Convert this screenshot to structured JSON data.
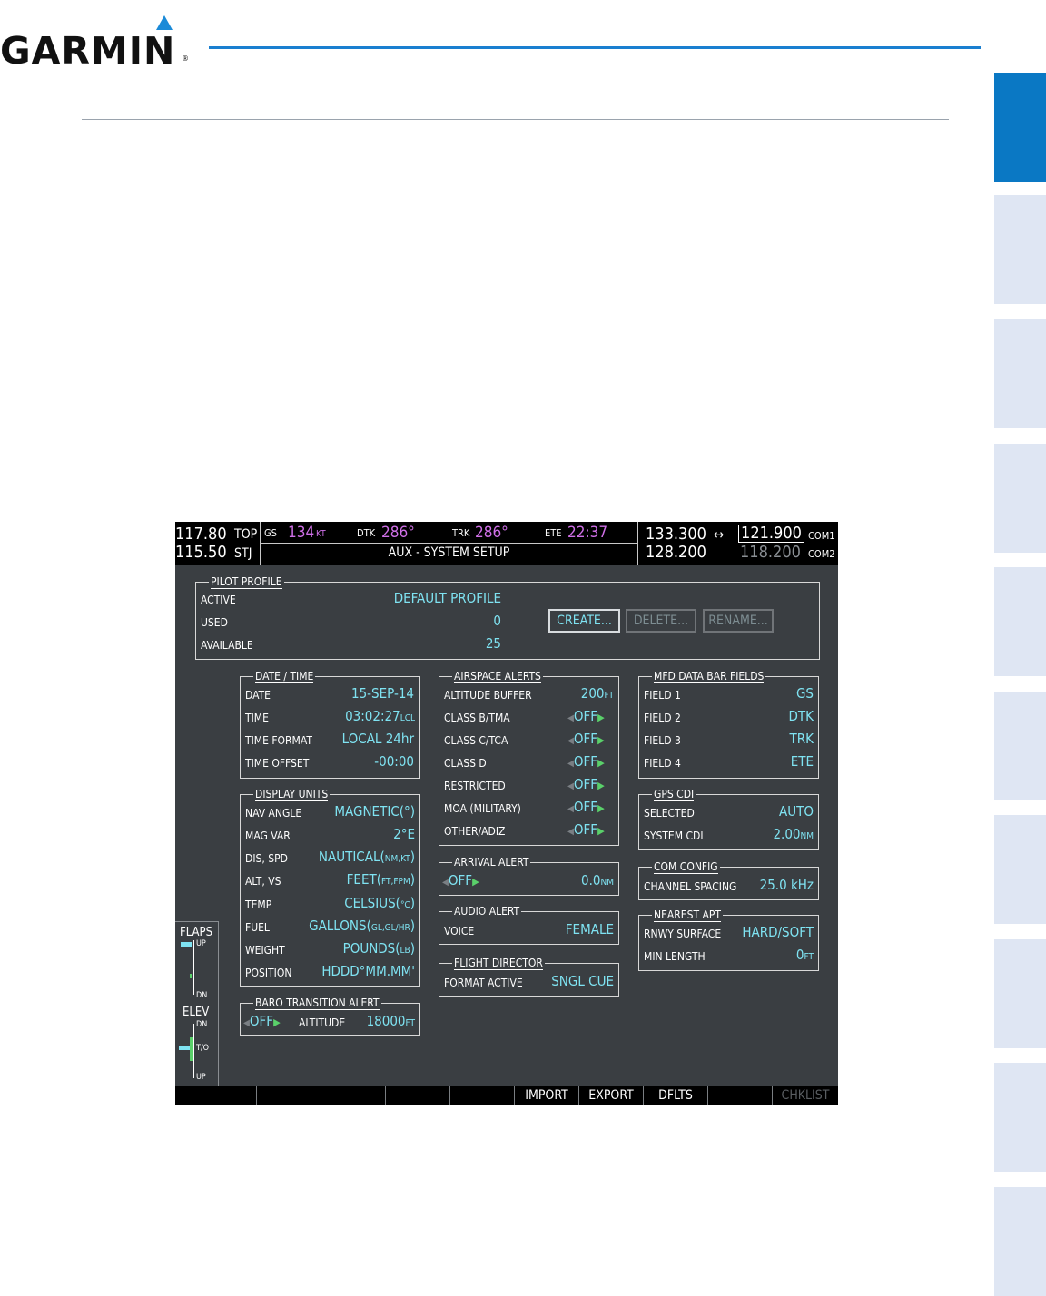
{
  "brand": {
    "logo_text": "GARMIN"
  },
  "screen": {
    "title": "AUX - SYSTEM SETUP",
    "topbar": {
      "nav1_active": "117.80",
      "nav1_ident": "TOP",
      "nav2_active": "115.50",
      "nav2_ident": "STJ",
      "gs_label": "GS",
      "gs_value": "134",
      "gs_unit": "KT",
      "dtk_label": "DTK",
      "dtk_value": "286°",
      "trk_label": "TRK",
      "trk_value": "286°",
      "ete_label": "ETE",
      "ete_value": "22:37",
      "com1_active": "133.300",
      "com1_standby": "121.900",
      "com1_label": "COM1",
      "swap_arrow": "↔",
      "com2_active": "128.200",
      "com2_standby": "118.200",
      "com2_label": "COM2"
    },
    "pilot_profile": {
      "title": "PILOT PROFILE",
      "active_label": "ACTIVE",
      "active_value": "DEFAULT PROFILE",
      "used_label": "USED",
      "used_value": "0",
      "available_label": "AVAILABLE",
      "available_value": "25",
      "create_label": "CREATE...",
      "delete_label": "DELETE...",
      "rename_label": "RENAME..."
    },
    "date_time": {
      "title": "DATE / TIME",
      "rows": [
        {
          "label": "DATE",
          "value": "15-SEP-14"
        },
        {
          "label": "TIME",
          "value": "03:02:27",
          "unit": "LCL"
        },
        {
          "label": "TIME FORMAT",
          "value": "LOCAL 24hr"
        },
        {
          "label": "TIME OFFSET",
          "value": "-00:00"
        }
      ]
    },
    "display_units": {
      "title": "DISPLAY UNITS",
      "rows": [
        {
          "label": "NAV ANGLE",
          "value": "MAGNETIC(°)"
        },
        {
          "label": "MAG VAR",
          "value": "2°E"
        },
        {
          "label": "DIS, SPD",
          "value": "NAUTICAL(",
          "unit": "NM,KT",
          "tail": ")"
        },
        {
          "label": "ALT, VS",
          "value": "FEET(",
          "unit": "FT,FPM",
          "tail": ")"
        },
        {
          "label": "TEMP",
          "value": "CELSIUS(",
          "unit": "°C",
          "tail": ")"
        },
        {
          "label": "FUEL",
          "value": "GALLONS(",
          "unit": "GL,GL/HR",
          "tail": ")"
        },
        {
          "label": "WEIGHT",
          "value": "POUNDS(",
          "unit": "LB",
          "tail": ")"
        },
        {
          "label": "POSITION",
          "value": "HDDD°MM.MM'"
        }
      ]
    },
    "baro_transition": {
      "title": "BARO TRANSITION ALERT",
      "state": "OFF",
      "altitude_label": "ALTITUDE",
      "altitude_value": "18000",
      "altitude_unit": "FT"
    },
    "airspace_alerts": {
      "title": "AIRSPACE ALERTS",
      "buffer_label": "ALTITUDE BUFFER",
      "buffer_value": "200",
      "buffer_unit": "FT",
      "rows": [
        {
          "label": "CLASS B/TMA",
          "value": "OFF"
        },
        {
          "label": "CLASS C/TCA",
          "value": "OFF"
        },
        {
          "label": "CLASS D",
          "value": "OFF"
        },
        {
          "label": "RESTRICTED",
          "value": "OFF"
        },
        {
          "label": "MOA (MILITARY)",
          "value": "OFF"
        },
        {
          "label": "OTHER/ADIZ",
          "value": "OFF"
        }
      ]
    },
    "arrival_alert": {
      "title": "ARRIVAL ALERT",
      "state": "OFF",
      "distance": "0.0",
      "unit": "NM"
    },
    "audio_alert": {
      "title": "AUDIO ALERT",
      "voice_label": "VOICE",
      "voice_value": "FEMALE"
    },
    "flight_director": {
      "title": "FLIGHT DIRECTOR",
      "label": "FORMAT ACTIVE",
      "value": "SNGL CUE"
    },
    "mfd_data_bar": {
      "title": "MFD DATA BAR FIELDS",
      "rows": [
        {
          "label": "FIELD 1",
          "value": "GS"
        },
        {
          "label": "FIELD 2",
          "value": "DTK"
        },
        {
          "label": "FIELD 3",
          "value": "TRK"
        },
        {
          "label": "FIELD 4",
          "value": "ETE"
        }
      ]
    },
    "gps_cdi": {
      "title": "GPS CDI",
      "selected_label": "SELECTED",
      "selected_value": "AUTO",
      "system_label": "SYSTEM CDI",
      "system_value": "2.00",
      "system_unit": "NM"
    },
    "com_config": {
      "title": "COM CONFIG",
      "label": "CHANNEL SPACING",
      "value": "25.0 kHz"
    },
    "nearest_apt": {
      "title": "NEAREST APT",
      "surface_label": "RNWY SURFACE",
      "surface_value": "HARD/SOFT",
      "length_label": "MIN LENGTH",
      "length_value": "0",
      "length_unit": "FT"
    },
    "trim": {
      "flaps_label": "FLAPS",
      "flaps_up": "UP",
      "flaps_dn": "DN",
      "elev_label": "ELEV",
      "elev_dn": "DN",
      "elev_to": "T/O",
      "elev_up": "UP"
    },
    "softkeys": [
      "",
      "",
      "",
      "",
      "",
      "IMPORT",
      "EXPORT",
      "DFLTS",
      "",
      "CHKLIST"
    ]
  }
}
